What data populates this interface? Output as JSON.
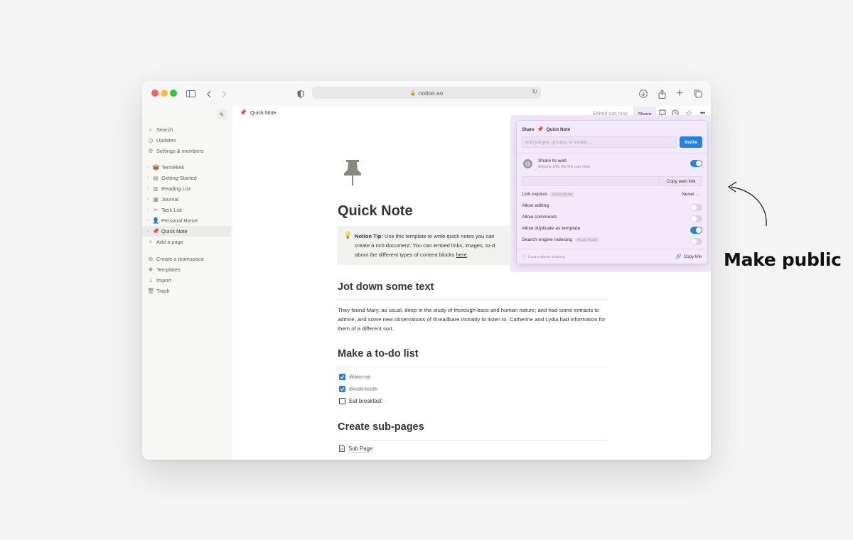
{
  "browser": {
    "url": "notion.so"
  },
  "sidebar": {
    "top_items": [
      {
        "icon": "search-icon",
        "label": "Search"
      },
      {
        "icon": "clock-icon",
        "label": "Updates"
      },
      {
        "icon": "gear-icon",
        "label": "Settings & members"
      }
    ],
    "pages": [
      {
        "icon": "package-icon",
        "label": "Termékek"
      },
      {
        "icon": "page-icon",
        "label": "Getting Started"
      },
      {
        "icon": "book-icon",
        "label": "Reading List"
      },
      {
        "icon": "journal-icon",
        "label": "Journal"
      },
      {
        "icon": "tools-icon",
        "label": "Task List"
      },
      {
        "icon": "person-icon",
        "label": "Personal Home"
      },
      {
        "icon": "pin-icon",
        "label": "Quick Note"
      }
    ],
    "add_page": "Add a page",
    "bottom_items": [
      {
        "icon": "teamspace-icon",
        "label": "Create a teamspace"
      },
      {
        "icon": "templates-icon",
        "label": "Templates"
      },
      {
        "icon": "import-icon",
        "label": "Import"
      },
      {
        "icon": "trash-icon",
        "label": "Trash"
      }
    ]
  },
  "topbar": {
    "breadcrumb": "Quick Note",
    "edited": "Edited just now",
    "share": "Share"
  },
  "page": {
    "title": "Quick Note",
    "callout": {
      "bold": "Notion Tip:",
      "text_1": " Use this template to write quick notes you can",
      "text_2": "create a rich document. You can embed links, images, to-d",
      "text_3": "about the different types of content blocks ",
      "link": "here",
      "end": "."
    },
    "section_1": "Jot down some text",
    "paragraph": "They found Mary, as usual, deep in the study of thorough-bass and human nature; and had some extracts to admire, and some new observations of threadbare morality to listen to. Catherine and Lydia had information for them of a different sort.",
    "section_2": "Make a to-do list",
    "todos": [
      {
        "label": "Wake up",
        "checked": true
      },
      {
        "label": "Brush teeth",
        "checked": true
      },
      {
        "label": "Eat breakfast",
        "checked": false
      }
    ],
    "section_3": "Create sub-pages",
    "subpage": "Sub Page"
  },
  "share_popup": {
    "header_label": "Share",
    "header_page": "Quick Note",
    "invite_placeholder": "Add people, groups, or emails...",
    "invite_button": "Invite",
    "share_to_web": "Share to web",
    "share_to_web_sub": "Anyone with the link can view",
    "share_to_web_on": true,
    "copy_web_link": "Copy web link",
    "link_expires": "Link expires",
    "plan_badge": "PLUS PLAN",
    "link_expires_value": "Never",
    "options": [
      {
        "label": "Allow editing",
        "on": false
      },
      {
        "label": "Allow comments",
        "on": false
      },
      {
        "label": "Allow duplicate as template",
        "on": true
      },
      {
        "label": "Search engine indexing",
        "on": false,
        "badge": "PLUS PLAN"
      }
    ],
    "learn": "Learn about sharing",
    "copy_link": "Copy link"
  },
  "annotation": {
    "text": "Make public"
  }
}
